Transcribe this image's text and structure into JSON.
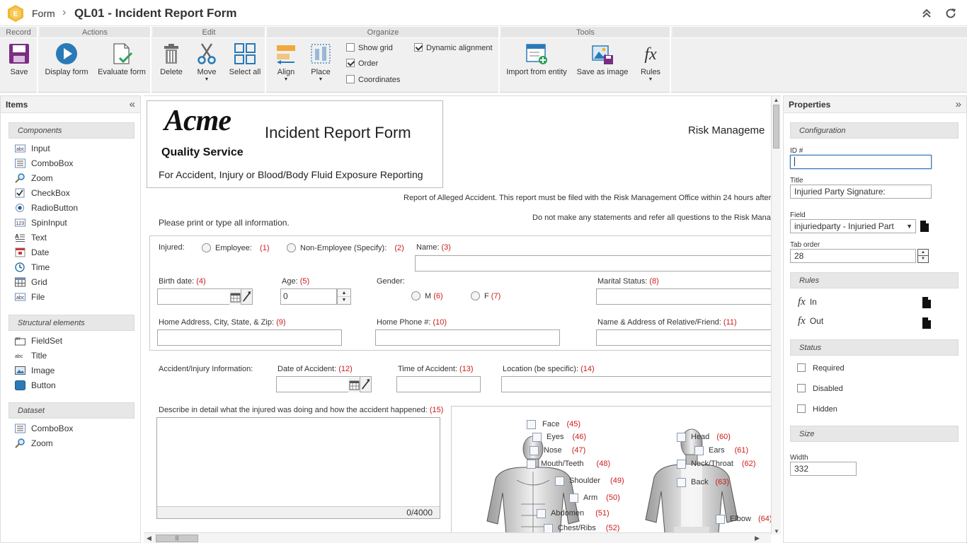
{
  "header": {
    "breadcrumb_form": "Form",
    "separator": "›",
    "title": "QL01 - Incident Report Form"
  },
  "ribbon": {
    "record": {
      "title": "Record",
      "save": "Save"
    },
    "actions": {
      "title": "Actions",
      "display_form": "Display form",
      "evaluate_form": "Evaluate form"
    },
    "edit": {
      "title": "Edit",
      "delete": "Delete",
      "move": "Move",
      "select_all": "Select all"
    },
    "organize": {
      "title": "Organize",
      "align": "Align",
      "place": "Place",
      "show_grid": "Show grid",
      "order": "Order",
      "coordinates": "Coordinates",
      "dynamic_alignment": "Dynamic alignment",
      "show_grid_checked": false,
      "order_checked": true,
      "coordinates_checked": false,
      "dynamic_alignment_checked": true
    },
    "tools": {
      "title": "Tools",
      "import_from_entity": "Import from entity",
      "save_as_image": "Save as image",
      "rules": "Rules"
    }
  },
  "items_panel": {
    "title": "Items",
    "components_title": "Components",
    "components": [
      "Input",
      "ComboBox",
      "Zoom",
      "CheckBox",
      "RadioButton",
      "SpinInput",
      "Text",
      "Date",
      "Time",
      "Grid",
      "File"
    ],
    "structural_title": "Structural elements",
    "structural": [
      "FieldSet",
      "Title",
      "Image",
      "Button"
    ],
    "dataset_title": "Dataset",
    "dataset": [
      "ComboBox",
      "Zoom"
    ]
  },
  "form": {
    "logo_script": "Acme",
    "logo_tagline": "Quality Service",
    "title": "Incident Report Form",
    "subtitle": "For Accident, Injury or Blood/Body Fluid Exposure Reporting",
    "risk_mgmt": "Risk Manageme",
    "notice1": "Report of Alleged Accident. This report must be filed with the Risk Management Office within 24 hours after",
    "notice2": "Do not make any statements and refer all questions to the Risk Manage",
    "print_note": "Please print or type all information.",
    "injured": "Injured:",
    "employee": "Employee:",
    "n1": "(1)",
    "non_employee": "Non-Employee (Specify):",
    "n2": "(2)",
    "name": "Name:",
    "n3": "(3)",
    "birth_date": "Birth date:",
    "n4": "(4)",
    "age": "Age:",
    "n5": "(5)",
    "age_value": "0",
    "gender": "Gender:",
    "male": "M",
    "n6": "(6)",
    "female": "F",
    "n7": "(7)",
    "marital": "Marital Status:",
    "n8": "(8)",
    "home_address": "Home Address, City, State, & Zip:",
    "n9": "(9)",
    "home_phone": "Home Phone #:",
    "n10": "(10)",
    "relative": "Name & Address of Relative/Friend:",
    "n11": "(11)",
    "accident_info": "Accident/Injury Information:",
    "date_accident": "Date of Accident:",
    "n12": "(12)",
    "time_accident": "Time of Accident:",
    "n13": "(13)",
    "location": "Location (be specific):",
    "n14": "(14)",
    "describe": "Describe in detail what the injured was doing and how the accident happened:",
    "n15": "(15)",
    "char_count": "0/4000",
    "body_front": [
      {
        "label": "Face",
        "n": "(45)"
      },
      {
        "label": "Eyes",
        "n": "(46)"
      },
      {
        "label": "Nose",
        "n": "(47)"
      },
      {
        "label": "Mouth/Teeth",
        "n": "(48)"
      },
      {
        "label": "Shoulder",
        "n": "(49)"
      },
      {
        "label": "Arm",
        "n": "(50)"
      },
      {
        "label": "Abdomen",
        "n": "(51)"
      },
      {
        "label": "Chest/Ribs",
        "n": "(52)"
      }
    ],
    "body_back": [
      {
        "label": "Head",
        "n": "(60)"
      },
      {
        "label": "Ears",
        "n": "(61)"
      },
      {
        "label": "Neck/Throat",
        "n": "(62)"
      },
      {
        "label": "Back",
        "n": "(63)"
      },
      {
        "label": "Elbow",
        "n": "(64)"
      }
    ]
  },
  "properties": {
    "title": "Properties",
    "configuration": "Configuration",
    "id_label": "ID #",
    "id_value": "",
    "title_label": "Title",
    "title_value": "Injuried Party Signature:",
    "field_label": "Field",
    "field_value": "injuriedparty - Injuried Part",
    "tab_order_label": "Tab order",
    "tab_order_value": "28",
    "rules": "Rules",
    "rule_in": "In",
    "rule_out": "Out",
    "status": "Status",
    "required": "Required",
    "disabled": "Disabled",
    "hidden": "Hidden",
    "size": "Size",
    "width_label": "Width",
    "width_value": "332"
  },
  "colors": {
    "accent": "#2a7ab8",
    "logo": "#f2b632",
    "save": "#7b2c83",
    "number_red": "#cc1b1b"
  }
}
